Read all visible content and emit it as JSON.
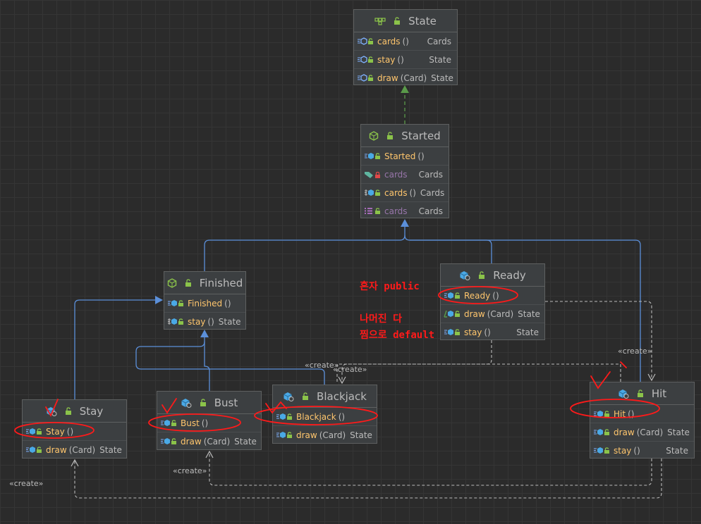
{
  "classes": {
    "state": {
      "name": "State",
      "members": [
        {
          "name": "cards",
          "params": "()",
          "type": "Cards"
        },
        {
          "name": "stay",
          "params": "()",
          "type": "State"
        },
        {
          "name": "draw",
          "params": "(Card)",
          "type": "State"
        }
      ]
    },
    "started": {
      "name": "Started",
      "members": [
        {
          "name": "Started",
          "params": "()",
          "type": ""
        },
        {
          "name": "cards",
          "params": "",
          "type": "Cards"
        },
        {
          "name": "cards",
          "params": "()",
          "type": "Cards"
        },
        {
          "name": "cards",
          "params": "",
          "type": "Cards"
        }
      ]
    },
    "finished": {
      "name": "Finished",
      "members": [
        {
          "name": "Finished",
          "params": "()",
          "type": ""
        },
        {
          "name": "stay",
          "params": "()",
          "type": "State"
        }
      ]
    },
    "ready": {
      "name": "Ready",
      "members": [
        {
          "name": "Ready",
          "params": "()",
          "type": ""
        },
        {
          "name": "draw",
          "params": "(Card)",
          "type": "State"
        },
        {
          "name": "stay",
          "params": "()",
          "type": "State"
        }
      ]
    },
    "stay": {
      "name": "Stay",
      "members": [
        {
          "name": "Stay",
          "params": "()",
          "type": ""
        },
        {
          "name": "draw",
          "params": "(Card)",
          "type": "State"
        }
      ]
    },
    "bust": {
      "name": "Bust",
      "members": [
        {
          "name": "Bust",
          "params": "()",
          "type": ""
        },
        {
          "name": "draw",
          "params": "(Card)",
          "type": "State"
        }
      ]
    },
    "blackjack": {
      "name": "Blackjack",
      "members": [
        {
          "name": "Blackjack",
          "params": "()",
          "type": ""
        },
        {
          "name": "draw",
          "params": "(Card)",
          "type": "State"
        }
      ]
    },
    "hit": {
      "name": "Hit",
      "members": [
        {
          "name": "Hit",
          "params": "()",
          "type": ""
        },
        {
          "name": "draw",
          "params": "(Card)",
          "type": "State"
        },
        {
          "name": "stay",
          "params": "()",
          "type": "State"
        }
      ]
    }
  },
  "stereotypes": {
    "create_label": "«create»"
  },
  "annotations": {
    "line1": "혼자 public",
    "line2": "나머진 다",
    "line3": "찜으로 default"
  },
  "colors": {
    "background": "#2b2b2b",
    "grid": "#353535",
    "node_fill": "#3c3f41",
    "inheritance": "#5b8fd9",
    "realization": "#5a9a4a",
    "dependency": "#bbbbbb",
    "method": "#ffc66d",
    "field": "#9876aa",
    "annotation": "#ff1a1a"
  }
}
